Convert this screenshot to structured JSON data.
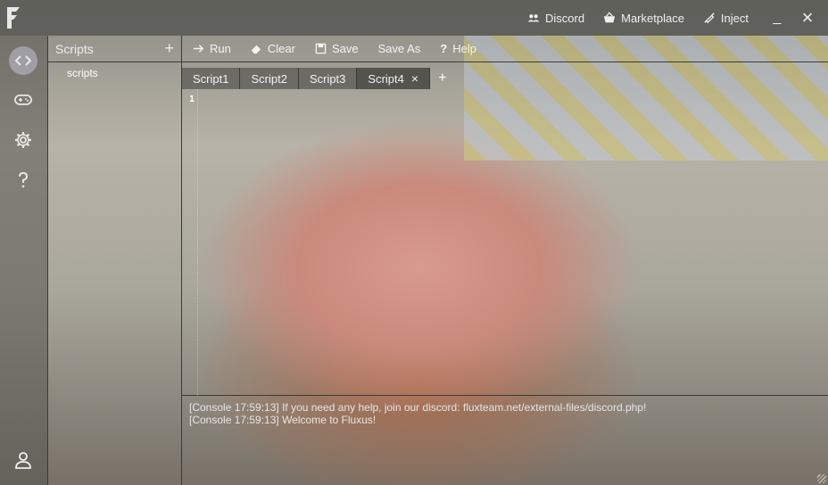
{
  "window": {
    "actions": [
      {
        "label": "Discord",
        "icon": "users-icon"
      },
      {
        "label": "Marketplace",
        "icon": "basket-icon"
      },
      {
        "label": "Inject",
        "icon": "syringe-icon"
      }
    ],
    "minimize_label": "_",
    "close_label": "×"
  },
  "sidebar": {
    "items": [
      {
        "name": "editor",
        "icon": "code-icon",
        "active": true
      },
      {
        "name": "games",
        "icon": "gamepad-icon",
        "active": false
      },
      {
        "name": "settings",
        "icon": "gear-icon",
        "active": false
      },
      {
        "name": "help",
        "icon": "question-icon",
        "active": false
      }
    ],
    "bottom_icon": "user-icon"
  },
  "scripts_panel": {
    "title": "Scripts",
    "add_label": "+",
    "folder": "scripts"
  },
  "toolbar": {
    "run": "Run",
    "clear": "Clear",
    "save": "Save",
    "save_as": "Save As",
    "help": "Help"
  },
  "tabs": [
    {
      "label": "Script1",
      "active": false
    },
    {
      "label": "Script2",
      "active": false
    },
    {
      "label": "Script3",
      "active": false
    },
    {
      "label": "Script4",
      "active": true
    }
  ],
  "tab_close": "×",
  "tab_add": "+",
  "editor": {
    "line_number": "1"
  },
  "console": [
    "[Console 17:59:13] If you need any help, join our discord: fluxteam.net/external-files/discord.php!",
    "[Console 17:59:13] Welcome to Fluxus!"
  ]
}
